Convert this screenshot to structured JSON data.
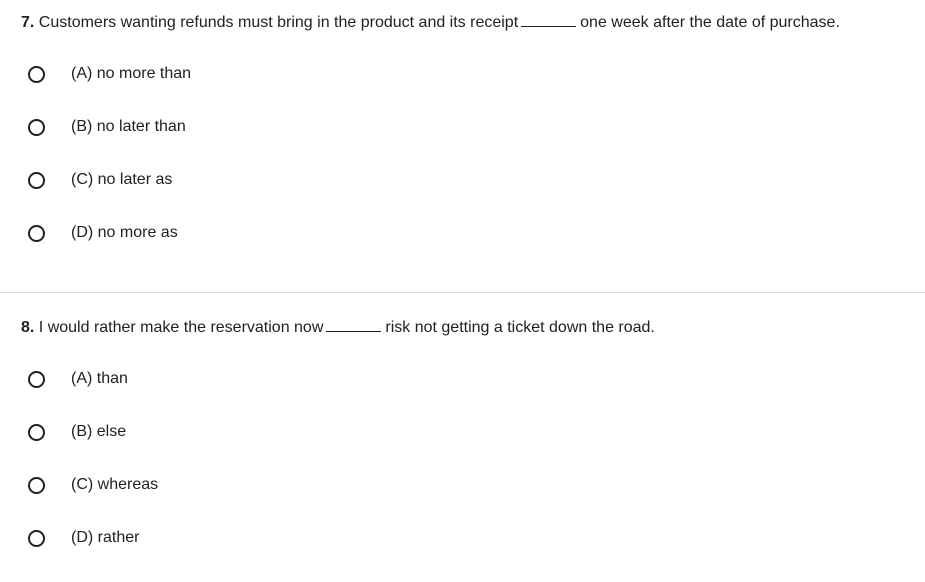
{
  "questions": [
    {
      "number": "7.",
      "text_before": "Customers wanting refunds must bring in the product and its receipt",
      "text_after": "one week after the date of purchase.",
      "options": [
        {
          "label": "(A) no more than"
        },
        {
          "label": "(B) no later than"
        },
        {
          "label": "(C) no later as"
        },
        {
          "label": "(D) no more as"
        }
      ]
    },
    {
      "number": "8.",
      "text_before": "I would rather make the reservation now",
      "text_after": "risk not getting a ticket down the road.",
      "options": [
        {
          "label": "(A) than"
        },
        {
          "label": "(B) else"
        },
        {
          "label": "(C) whereas"
        },
        {
          "label": "(D) rather"
        }
      ]
    }
  ]
}
